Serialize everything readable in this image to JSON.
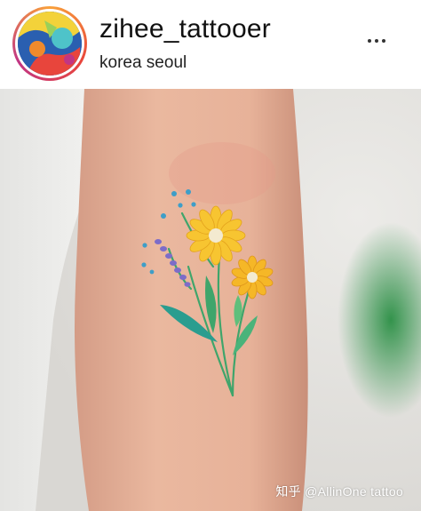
{
  "post_header": {
    "username": "zihee_tattooer",
    "location": "korea seoul",
    "more_icon": "more-horizontal-icon"
  },
  "post_image": {
    "subject": "tattoo-photo",
    "watermark": "知乎 @AllinOne tattoo"
  },
  "colors": {
    "header_bg": "#ffffff",
    "username_text": "#111111",
    "skin": "#e9b49a",
    "shirt": "#f2f2f0",
    "leaf_green": "#2f9a4c",
    "petal_yellow": "#f7c531",
    "lavender": "#7d6cc8"
  }
}
